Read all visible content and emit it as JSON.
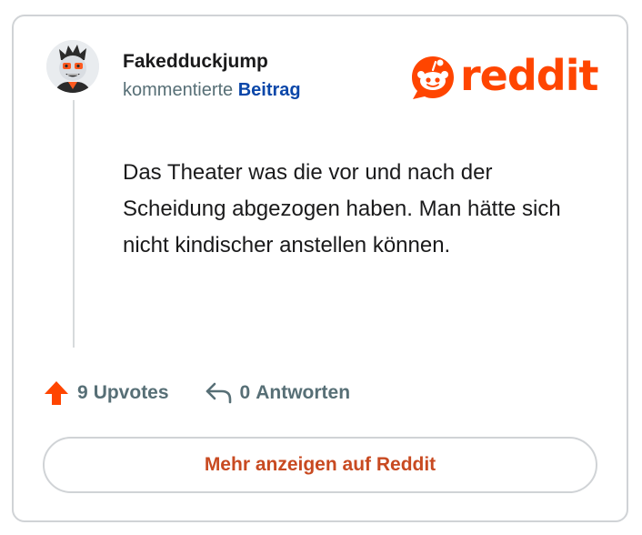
{
  "comment": {
    "username": "Fakedduckjump",
    "action_text": "kommentierte",
    "target_link": "Beitrag",
    "body": "Das Theater was die vor und nach der Scheidung abgezogen haben. Man hätte sich nicht kindischer anstellen können."
  },
  "logo": {
    "wordmark": "reddit",
    "icon": "reddit-snoo-icon"
  },
  "stats": {
    "upvotes_count": "9",
    "upvotes_label": "Upvotes",
    "upvote_icon": "upvote-arrow-icon",
    "replies_count": "0",
    "replies_label": "Antworten",
    "reply_icon": "reply-arrow-icon"
  },
  "cta": {
    "label": "Mehr anzeigen auf Reddit"
  },
  "colors": {
    "brand": "#ff4500",
    "link": "#0b47a9",
    "muted": "#576f76",
    "cta_text": "#c84a21",
    "border": "#d0d3d6"
  }
}
